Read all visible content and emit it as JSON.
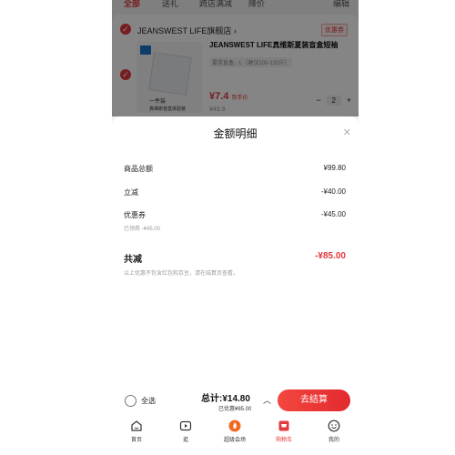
{
  "colors": {
    "accent": "#e4393c",
    "overlay": "rgba(0,0,0,0.48)",
    "muted": "#999999"
  },
  "filter_tabs": [
    {
      "label": "全部",
      "active": true
    },
    {
      "label": "送礼",
      "active": false
    },
    {
      "label": "跨店满减",
      "active": false
    },
    {
      "label": "降价",
      "active": false
    }
  ],
  "filter_edit": "编辑",
  "store": {
    "name": "JEANSWEST LIFE旗舰店 ›",
    "coupon_tag": "优惠券"
  },
  "product": {
    "title": "JEANSWEST LIFE真维斯夏装盲盒短袖",
    "spec": "要求盲盒，L（建议100-120斤）",
    "image_label": "一件装",
    "image_caption": "真维斯盲盒体验装",
    "price_current": "¥7.4",
    "price_note": "到手价",
    "price_original": "¥49.9",
    "quantity": "2",
    "qty_minus": "−",
    "qty_plus": "+"
  },
  "sheet": {
    "title": "金额明细",
    "close_icon": "close-icon",
    "rows": [
      {
        "label": "商品总额",
        "value": "¥99.80"
      },
      {
        "label": "立减",
        "value": "-¥40.00"
      },
      {
        "label": "优惠券",
        "value": "-¥45.00",
        "sub": "已领券 -¥45.00"
      }
    ],
    "total": {
      "label": "共减",
      "value": "-¥85.00"
    },
    "note": "以上优惠不包含红包和京豆，请在结算页查看。"
  },
  "checkout": {
    "select_all": "全选",
    "sum": "总计:¥14.80",
    "sum_sub": "已优惠¥85.00",
    "pay_button": "去结算"
  },
  "tabbar": [
    {
      "label": "首页",
      "icon": "home-icon"
    },
    {
      "label": "逛",
      "icon": "video-icon"
    },
    {
      "label": "超级会场",
      "icon": "fire-icon"
    },
    {
      "label": "购物车",
      "icon": "cart-icon",
      "active": true
    },
    {
      "label": "我的",
      "icon": "smile-icon"
    }
  ]
}
